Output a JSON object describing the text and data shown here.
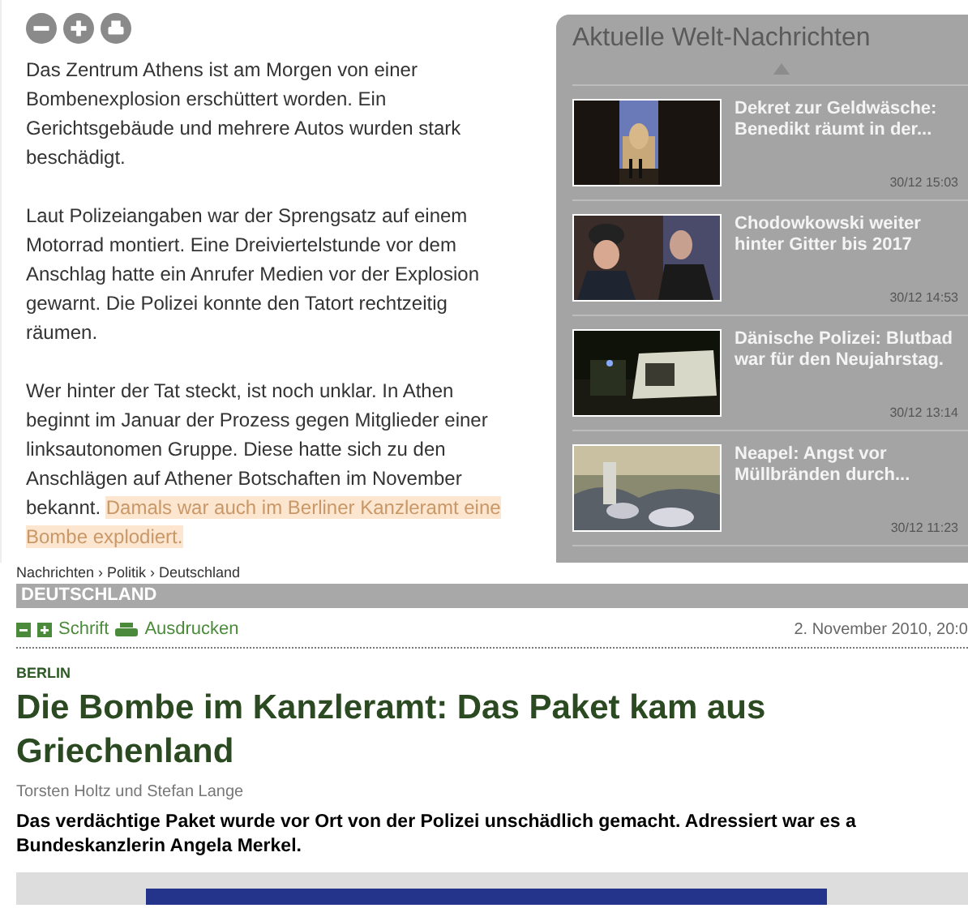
{
  "article_top": {
    "paragraphs": [
      {
        "text": "Das Zentrum Athens ist am Morgen von einer Bombenexplosion erschüttert worden. Ein Gerichtsgebäude und mehrere Autos wurden stark beschädigt."
      },
      {
        "text": "Laut Polizeiangaben war der Sprengsatz auf einem Motorrad montiert. Eine Dreiviertelstunde vor dem Anschlag hatte ein Anrufer Medien vor der Explosion gewarnt. Die Polizei konnte den Tatort rechtzeitig räumen."
      },
      {
        "text": "Wer hinter der Tat steckt, ist noch unklar. In Athen beginnt im Januar der Prozess gegen Mitglieder einer linksautonomen Gruppe. Diese hatte sich zu den Anschlägen auf Athener Botschaften im November bekannt. ",
        "highlight": "Damals war auch im Berliner Kanzleramt eine Bombe explodiert."
      }
    ]
  },
  "news_panel": {
    "title": "Aktuelle Welt-Nachrichten",
    "items": [
      {
        "title": "Dekret zur Geldwäsche: Benedikt räumt in der...",
        "time": "30/12 15:03",
        "kind": "picture"
      },
      {
        "title": "Chodowkowski weiter hinter Gitter bis 2017",
        "time": "30/12 14:53",
        "kind": "picture"
      },
      {
        "title": "Dänische Polizei: Blutbad war für den Neujahrstag.",
        "time": "30/12 13:14",
        "kind": "picture"
      },
      {
        "title": "Neapel: Angst vor Müllbränden durch...",
        "time": "30/12 11:23",
        "kind": "picture"
      }
    ]
  },
  "article_bottom": {
    "breadcrumb": "Nachrichten › Politik › Deutschland",
    "section": "DEUTSCHLAND",
    "toolbar": {
      "font_label": "Schrift",
      "print_label": "Ausdrucken",
      "date": "2. November 2010, 20:0"
    },
    "kicker": "BERLIN",
    "headline": "Die Bombe im Kanzleramt: Das Paket kam aus Griechenland",
    "authors": "Torsten Holtz und Stefan Lange",
    "lead": "Das verdächtige Paket wurde vor Ort von der Polizei unschädlich gemacht. Adressiert war es a Bundeskanzlerin Angela Merkel."
  }
}
